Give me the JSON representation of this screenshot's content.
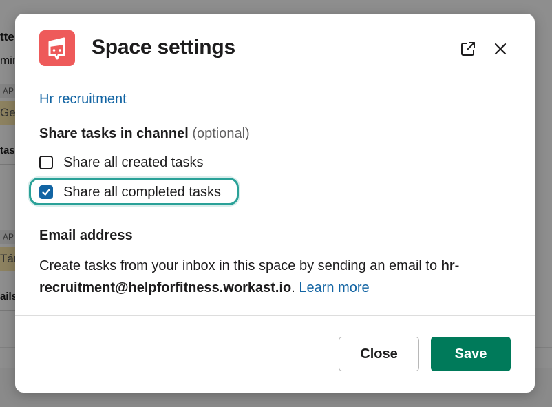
{
  "background": {
    "fragments": [
      "tte",
      "min",
      "AP",
      "Get",
      "tas",
      "AP",
      "Tár",
      "ails"
    ]
  },
  "modal": {
    "title": "Space settings",
    "logo_icon": "workast-chat-flag-icon",
    "popout_icon": "external-link-icon",
    "close_icon": "close-icon",
    "space_name": "Hr recruitment",
    "share_section": {
      "title": "Share tasks in channel",
      "optional": "(optional)",
      "options": [
        {
          "label": "Share all created tasks",
          "checked": false
        },
        {
          "label": "Share all completed tasks",
          "checked": true
        }
      ]
    },
    "email_section": {
      "title": "Email address",
      "description_prefix": "Create tasks from your inbox in this space by sending an email to ",
      "email": "hr-recruitment@helpforfitness.workast.io",
      "description_suffix": ". ",
      "learn_more": "Learn more"
    },
    "buttons": {
      "close": "Close",
      "save": "Save"
    },
    "colors": {
      "logo_bg": "#ee5a5a",
      "link": "#1264a3",
      "save_bg": "#007a5a",
      "highlight_ring": "#2aa198"
    }
  }
}
